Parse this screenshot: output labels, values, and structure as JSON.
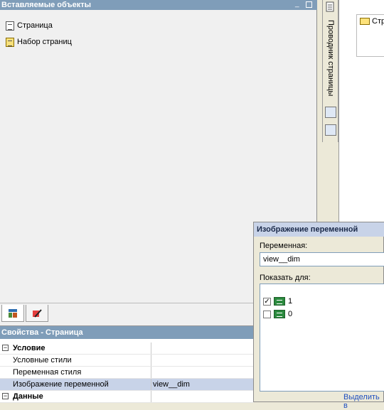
{
  "inserted_objects": {
    "title": "Вставляемые объекты",
    "items": [
      {
        "label": "Страница",
        "icon": "page-icon"
      },
      {
        "label": "Набор страниц",
        "icon": "page-set-icon"
      }
    ]
  },
  "side_strip": {
    "tab_label": "Проводник страницы"
  },
  "explorer": {
    "root_label": "Стр"
  },
  "variable_dialog": {
    "title": "Изображение переменной",
    "variable_label": "Переменная:",
    "variable_value": "view__dim",
    "show_for_label": "Показать для:",
    "options": [
      {
        "label": "1",
        "checked": true
      },
      {
        "label": "0",
        "checked": false
      }
    ],
    "select_link": "Выделить в"
  },
  "properties": {
    "title": "Свойства - Страница",
    "rows": [
      {
        "name": "Условие",
        "value": "",
        "group": true
      },
      {
        "name": "Условные стили",
        "value": ""
      },
      {
        "name": "Переменная стиля",
        "value": ""
      },
      {
        "name": "Изображение переменной",
        "value": "view__dim",
        "selected": true
      },
      {
        "name": "Данные",
        "value": "",
        "group": true
      }
    ]
  }
}
